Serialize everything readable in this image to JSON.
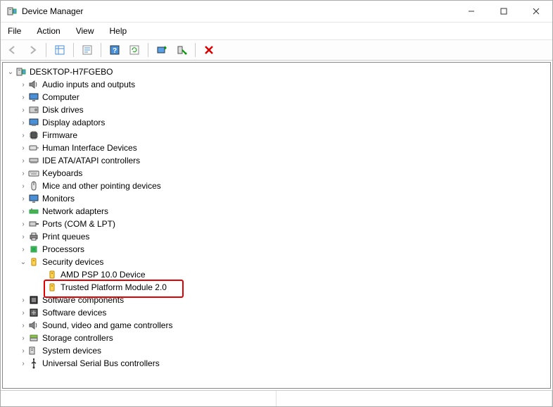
{
  "window": {
    "title": "Device Manager"
  },
  "menu": {
    "file": "File",
    "action": "Action",
    "view": "View",
    "help": "Help"
  },
  "toolbar": {
    "back": "Back",
    "forward": "Forward",
    "show_hidden": "Show hidden devices",
    "properties": "Properties",
    "help": "Help",
    "refresh": "Refresh",
    "update_driver": "Update driver",
    "uninstall": "Uninstall device",
    "disable": "Disable device"
  },
  "tree": {
    "root": "DESKTOP-H7FGEBO",
    "items": [
      {
        "label": "Audio inputs and outputs",
        "icon": "speaker"
      },
      {
        "label": "Computer",
        "icon": "monitor"
      },
      {
        "label": "Disk drives",
        "icon": "disk"
      },
      {
        "label": "Display adaptors",
        "icon": "display"
      },
      {
        "label": "Firmware",
        "icon": "chip"
      },
      {
        "label": "Human Interface Devices",
        "icon": "hid"
      },
      {
        "label": "IDE ATA/ATAPI controllers",
        "icon": "ide"
      },
      {
        "label": "Keyboards",
        "icon": "keyboard"
      },
      {
        "label": "Mice and other pointing devices",
        "icon": "mouse"
      },
      {
        "label": "Monitors",
        "icon": "monitor"
      },
      {
        "label": "Network adapters",
        "icon": "net"
      },
      {
        "label": "Ports (COM & LPT)",
        "icon": "port"
      },
      {
        "label": "Print queues",
        "icon": "printer"
      },
      {
        "label": "Processors",
        "icon": "cpu"
      },
      {
        "label": "Security devices",
        "icon": "security",
        "expanded": true,
        "children": [
          {
            "label": "AMD PSP 10.0 Device",
            "icon": "security"
          },
          {
            "label": "Trusted Platform Module 2.0",
            "icon": "security",
            "highlight": true
          }
        ]
      },
      {
        "label": "Software components",
        "icon": "softcomp"
      },
      {
        "label": "Software devices",
        "icon": "softdev"
      },
      {
        "label": "Sound, video and game controllers",
        "icon": "speaker"
      },
      {
        "label": "Storage controllers",
        "icon": "storage"
      },
      {
        "label": "System devices",
        "icon": "system"
      },
      {
        "label": "Universal Serial Bus controllers",
        "icon": "usb"
      }
    ]
  }
}
